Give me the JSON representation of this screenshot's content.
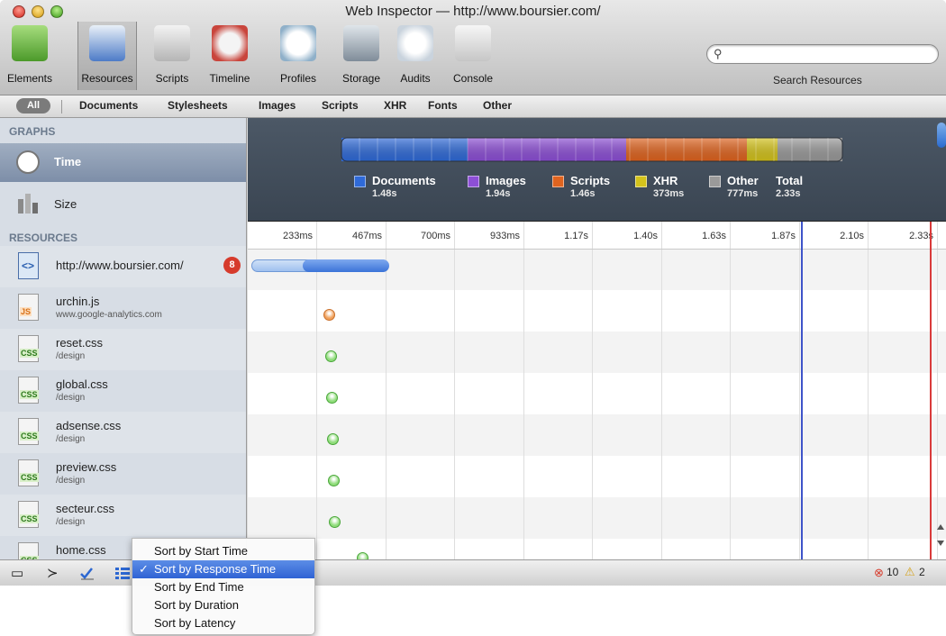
{
  "window": {
    "title": "Web Inspector — http://www.boursier.com/"
  },
  "toolbar": {
    "tools": [
      {
        "label": "Elements",
        "color": "#6bb64a"
      },
      {
        "label": "Resources",
        "color": "#4d7bc7"
      },
      {
        "label": "Scripts",
        "color": "#b9b9b9"
      },
      {
        "label": "Timeline",
        "color": "#c9453c"
      },
      {
        "label": "Profiles",
        "color": "#8fb0c9"
      },
      {
        "label": "Storage",
        "color": "#9aa6b3"
      },
      {
        "label": "Audits",
        "color": "#c9d3dd"
      },
      {
        "label": "Console",
        "color": "#d9d9d9"
      }
    ],
    "search_label": "Search Resources"
  },
  "filters": {
    "all": "All",
    "items": [
      "Documents",
      "Stylesheets",
      "Images",
      "Scripts",
      "XHR",
      "Fonts",
      "Other"
    ]
  },
  "sidebar": {
    "graphs_header": "GRAPHS",
    "time": "Time",
    "size": "Size",
    "resources_header": "RESOURCES",
    "resources": [
      {
        "name": "http://www.boursier.com/",
        "path": "",
        "type": "doc",
        "badge": "8"
      },
      {
        "name": "urchin.js",
        "path": "www.google-analytics.com",
        "type": "JS"
      },
      {
        "name": "reset.css",
        "path": "/design",
        "type": "CSS"
      },
      {
        "name": "global.css",
        "path": "/design",
        "type": "CSS"
      },
      {
        "name": "adsense.css",
        "path": "/design",
        "type": "CSS"
      },
      {
        "name": "preview.css",
        "path": "/design",
        "type": "CSS"
      },
      {
        "name": "secteur.css",
        "path": "/design",
        "type": "CSS"
      },
      {
        "name": "home.css",
        "path": "",
        "type": "CSS"
      }
    ]
  },
  "summary": {
    "legend": [
      {
        "name": "Documents",
        "value": "1.48s",
        "color": "#2f6ad8"
      },
      {
        "name": "Images",
        "value": "1.94s",
        "color": "#8d4fd6"
      },
      {
        "name": "Scripts",
        "value": "1.46s",
        "color": "#e0641f"
      },
      {
        "name": "XHR",
        "value": "373ms",
        "color": "#d4c31b"
      },
      {
        "name": "Other",
        "value": "777ms",
        "color": "#9a9a9a"
      },
      {
        "name": "Total",
        "value": "2.33s",
        "color": ""
      }
    ]
  },
  "timeline": {
    "ticks": [
      "233ms",
      "467ms",
      "700ms",
      "933ms",
      "1.17s",
      "1.40s",
      "1.63s",
      "1.87s",
      "2.10s",
      "2.33s"
    ]
  },
  "status": {
    "errors": "10",
    "warnings": "2"
  },
  "sort_menu": {
    "items": [
      {
        "label": "Sort by Start Time",
        "checked": false
      },
      {
        "label": "Sort by Response Time",
        "checked": true
      },
      {
        "label": "Sort by End Time",
        "checked": false
      },
      {
        "label": "Sort by Duration",
        "checked": false
      },
      {
        "label": "Sort by Latency",
        "checked": false
      }
    ],
    "check": "✓"
  },
  "icons": {
    "search": "⚲",
    "dock": "▭",
    "console": "≻",
    "errors": "⊗",
    "warnings": "⚠"
  }
}
